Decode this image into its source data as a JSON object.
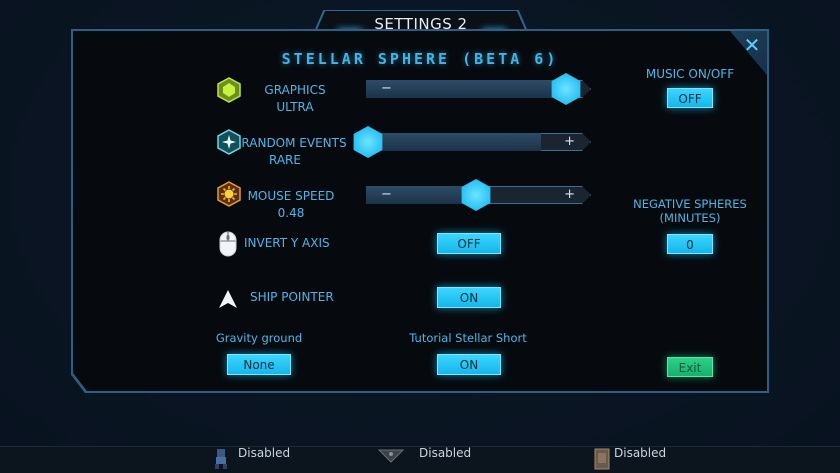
{
  "window": {
    "title": "SETTINGS 2",
    "subtitle": "STELLAR SPHERE (BETA 6)",
    "close_label": "✕"
  },
  "colors": {
    "accent": "#2ec4f5",
    "panel": "#060a0f",
    "exit": "#16b06c"
  },
  "settings": {
    "graphics": {
      "label": "GRAPHICS",
      "value": "ULTRA",
      "minus": "−",
      "level": 0.88,
      "icon": "gem-icon"
    },
    "random_events": {
      "label": "RANDOM EVENTS",
      "value": "RARE",
      "plus": "+",
      "level": 0.0,
      "icon": "star-burst-icon"
    },
    "mouse_speed": {
      "label": "MOUSE SPEED",
      "value": "0.48",
      "minus": "−",
      "plus": "+",
      "level": 0.48,
      "icon": "sun-icon"
    },
    "invert_y": {
      "label": "INVERT Y AXIS",
      "value": "OFF",
      "icon": "mouse-icon"
    },
    "ship_pointer": {
      "label": "SHIP POINTER",
      "value": "ON",
      "icon": "arrow-pointer-icon"
    },
    "gravity_ground": {
      "label": "Gravity ground",
      "value": "None"
    },
    "tutorial": {
      "label": "Tutorial Stellar Short",
      "value": "ON"
    },
    "music": {
      "label": "MUSIC ON/OFF",
      "value": "OFF"
    },
    "negative_spheres": {
      "label_line1": "NEGATIVE SPHERES",
      "label_line2": "(MINUTES)",
      "value": "0"
    },
    "exit": {
      "label": "Exit"
    }
  },
  "bottom_bar": [
    {
      "label": "Disabled",
      "icon": "figure-icon"
    },
    {
      "label": "Disabled",
      "icon": "shield-icon"
    },
    {
      "label": "Disabled",
      "icon": "card-icon"
    }
  ]
}
